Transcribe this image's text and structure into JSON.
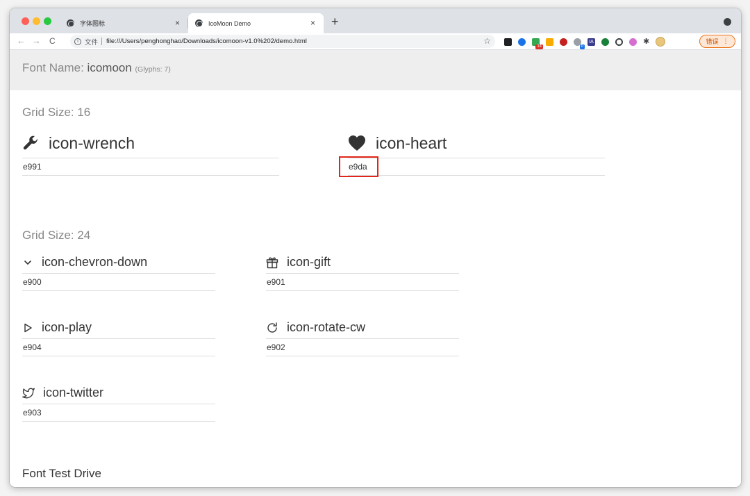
{
  "browser": {
    "tabs": [
      {
        "title": "字体图标",
        "active": false
      },
      {
        "title": "IcoMoon Demo",
        "active": true
      }
    ],
    "close_glyph": "×",
    "new_tab_glyph": "+",
    "address": {
      "info_glyph": "i",
      "label": "文件",
      "url": "file:///Users/penghonghao/Downloads/icomoon-v1.0%202/demo.html"
    },
    "nav": {
      "back": "←",
      "forward": "→",
      "reload": "C"
    },
    "bookmark_glyph": "☆",
    "extensions": {
      "badge_1": "14",
      "badge_2": "0",
      "ia_label": "IA",
      "puzzle_glyph": "✱"
    },
    "error_button": {
      "label": "错误",
      "menu_glyph": "⋮"
    },
    "colors": {
      "traffic_red": "#ff5f57",
      "traffic_yellow": "#febc2e",
      "traffic_green": "#28c840",
      "error_accent": "#e8711a"
    }
  },
  "header": {
    "prefix": "Font Name:",
    "font_name": "icomoon",
    "glyphs": "(Glyphs: 7)"
  },
  "sections": [
    {
      "title": "Grid Size: 16",
      "items": [
        {
          "name": "icon-wrench",
          "code": "e991",
          "icon": "wrench-icon"
        },
        {
          "name": "icon-heart",
          "code": "e9da",
          "icon": "heart-icon",
          "highlighted": true
        }
      ]
    },
    {
      "title": "Grid Size: 24",
      "items": [
        {
          "name": "icon-chevron-down",
          "code": "e900",
          "icon": "chevron-down-icon"
        },
        {
          "name": "icon-gift",
          "code": "e901",
          "icon": "gift-icon"
        },
        {
          "name": "icon-play",
          "code": "e904",
          "icon": "play-icon"
        },
        {
          "name": "icon-rotate-cw",
          "code": "e902",
          "icon": "rotate-cw-icon"
        },
        {
          "name": "icon-twitter",
          "code": "e903",
          "icon": "twitter-icon"
        }
      ]
    }
  ],
  "footer_title": "Font Test Drive",
  "highlight_color": "#e0261b"
}
